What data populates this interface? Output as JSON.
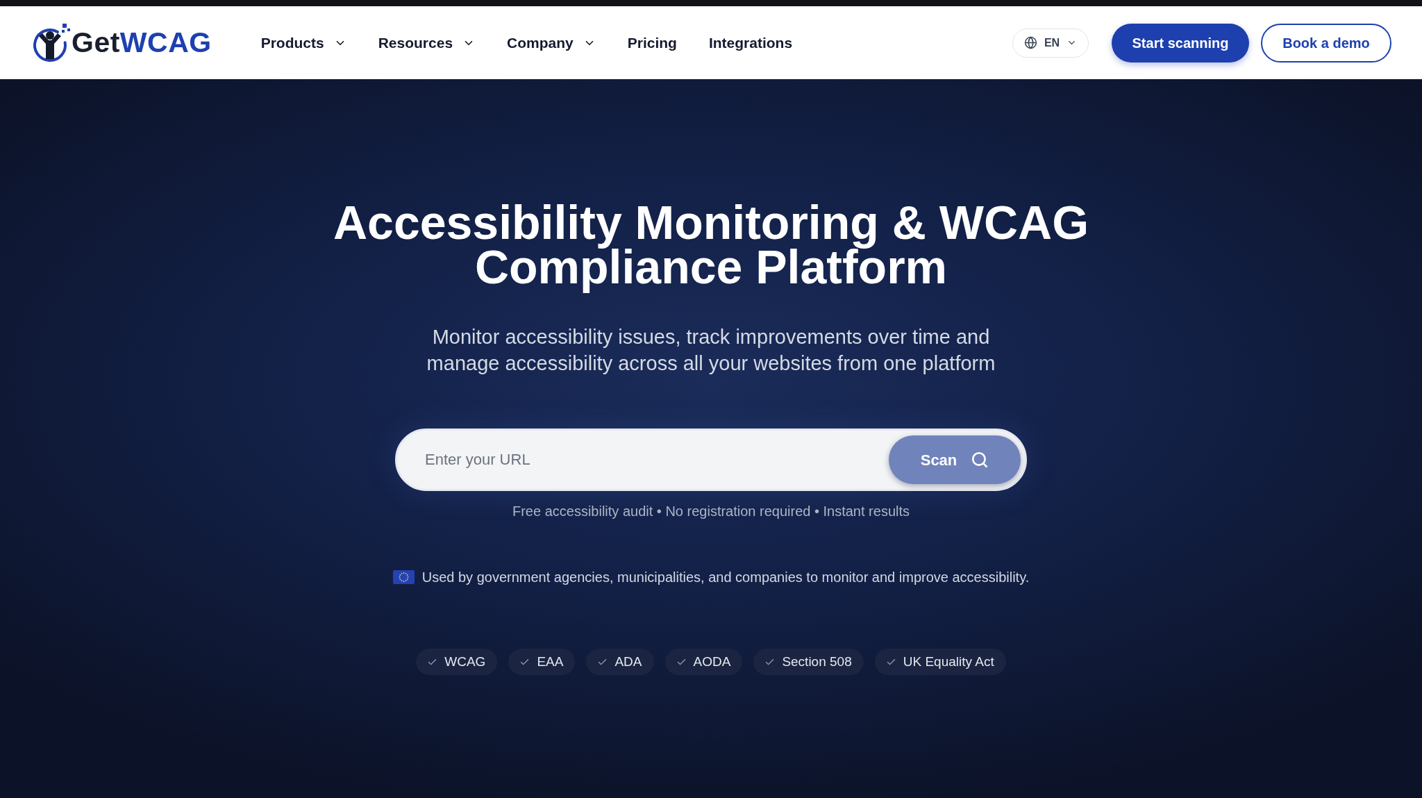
{
  "header": {
    "logo": {
      "prefix": "Get",
      "accent": "WCAG"
    },
    "nav": [
      {
        "label": "Products",
        "dropdown": true
      },
      {
        "label": "Resources",
        "dropdown": true
      },
      {
        "label": "Company",
        "dropdown": true
      },
      {
        "label": "Pricing",
        "dropdown": false
      },
      {
        "label": "Integrations",
        "dropdown": false
      }
    ],
    "language": {
      "code": "EN"
    },
    "buttons": [
      {
        "label": "Start scanning",
        "kind": "primary"
      },
      {
        "label": "Book a demo",
        "kind": "outline"
      }
    ]
  },
  "hero": {
    "title": "Accessibility Monitoring & WCAG Compliance Platform",
    "subtitle": "Monitor accessibility issues, track improvements over time and manage accessibility across all your websites from one platform",
    "search": {
      "placeholder": "Enter your URL",
      "button": "Scan"
    },
    "caption": "Free accessibility audit • No registration required • Instant results",
    "trust_note": "Used by government agencies, municipalities, and companies to monitor and improve accessibility.",
    "standards": [
      "WCAG",
      "EAA",
      "ADA",
      "AODA",
      "Section 508",
      "UK Equality Act"
    ]
  }
}
